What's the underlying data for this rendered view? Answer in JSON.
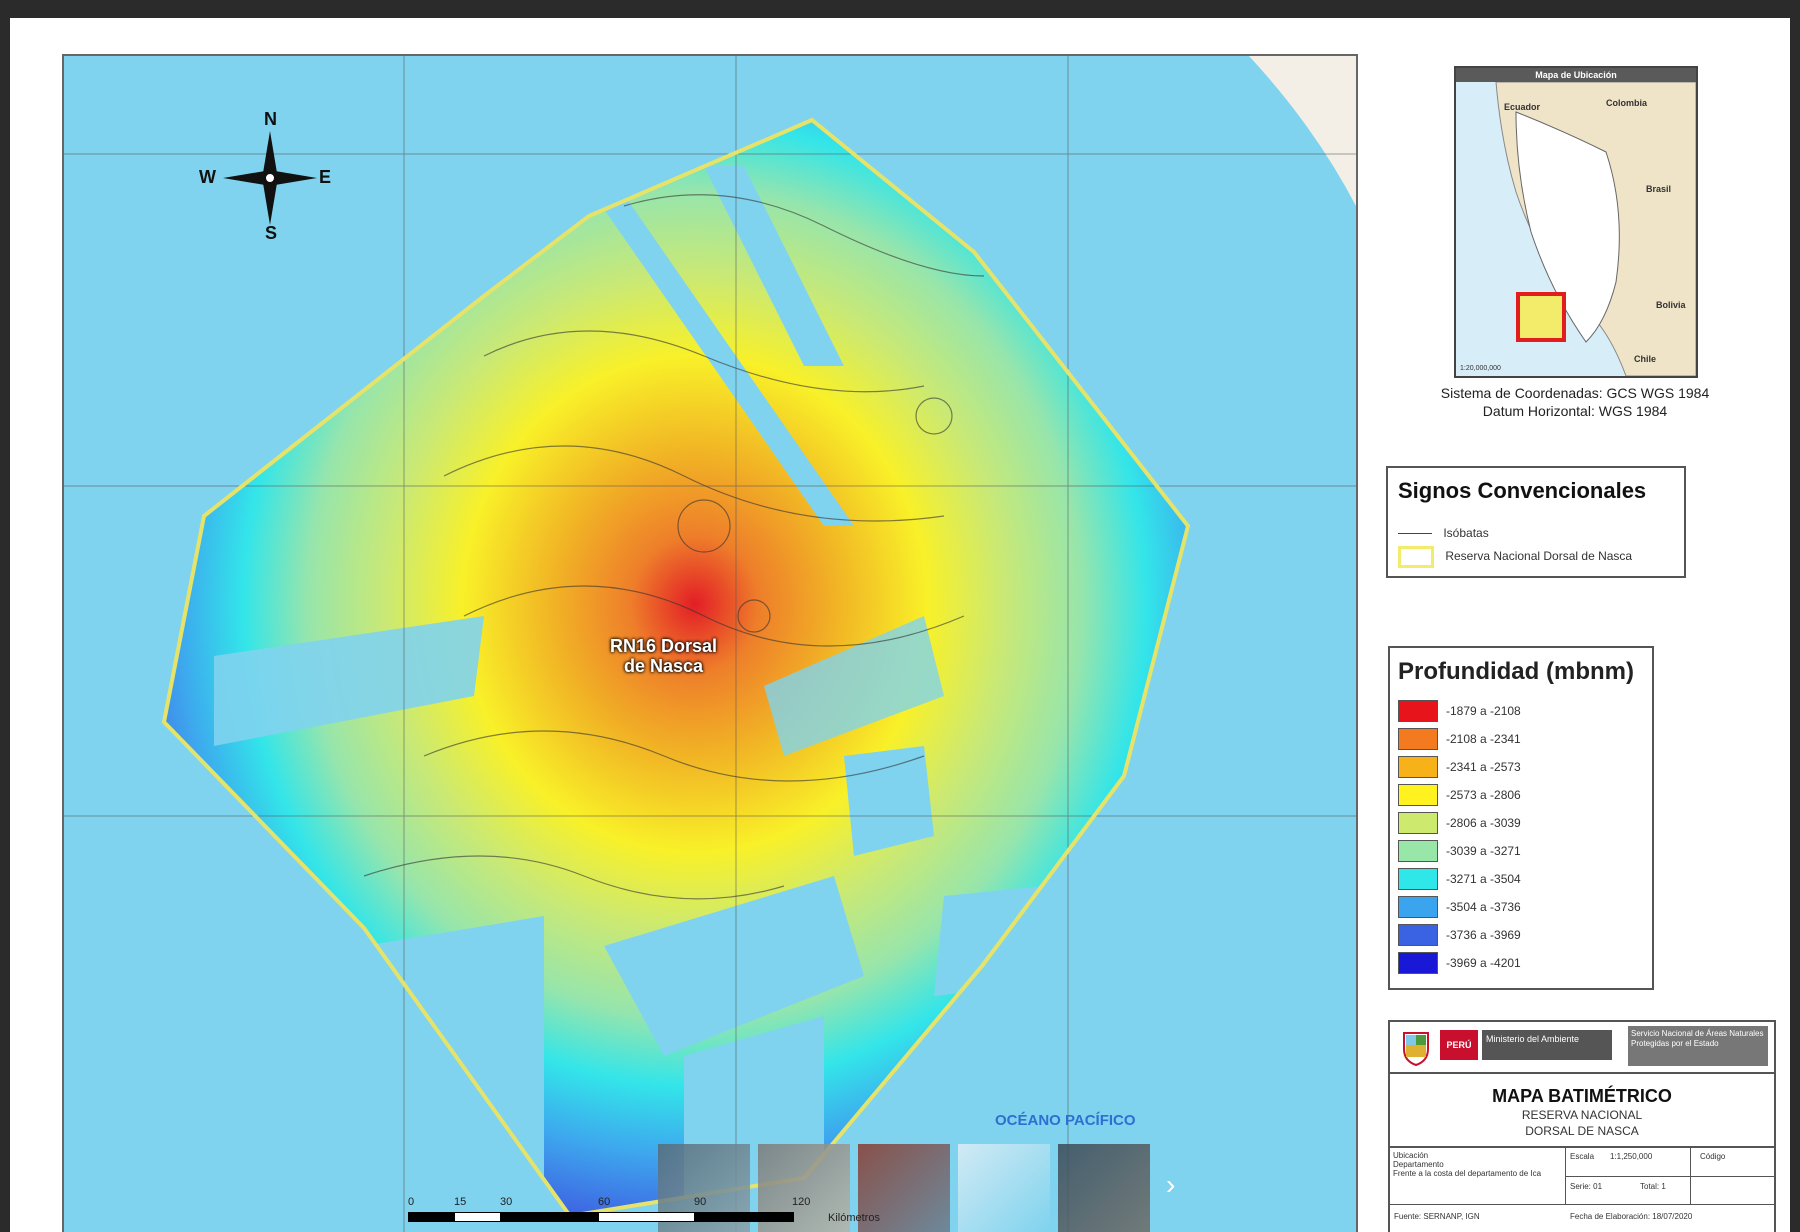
{
  "map": {
    "name_label_line1": "RN16 Dorsal",
    "name_label_line2": "de Nasca",
    "ocean_label": "OCÉANO PACÍFICO",
    "compass": {
      "n": "N",
      "s": "S",
      "e": "E",
      "w": "W"
    },
    "scale": {
      "ticks": [
        "0",
        "15",
        "30",
        "60",
        "90",
        "120"
      ],
      "unit": "Kilómetros"
    }
  },
  "location_map": {
    "title": "Mapa de Ubicación",
    "countries": [
      "Ecuador",
      "Colombia",
      "Brasil",
      "Bolivia",
      "Chile"
    ],
    "scale_text": "1:20,000,000"
  },
  "coordinate_system": {
    "line1": "Sistema de Coordenadas: GCS WGS 1984",
    "line2": "Datum Horizontal: WGS 1984"
  },
  "signos": {
    "title": "Signos Convencionales",
    "items": [
      {
        "label": "Isóbatas",
        "color": "#444444"
      },
      {
        "label": "Reserva Nacional Dorsal de Nasca",
        "color": "#f2ec6a"
      }
    ]
  },
  "profundidad": {
    "title": "Profundidad (mbnm)",
    "items": [
      {
        "label": "-1879 a -2108",
        "color": "#e8141c"
      },
      {
        "label": "-2108 a -2341",
        "color": "#f47a20"
      },
      {
        "label": "-2341 a -2573",
        "color": "#f7b21a"
      },
      {
        "label": "-2573 a -2806",
        "color": "#fff21e"
      },
      {
        "label": "-2806 a -3039",
        "color": "#cdea6f"
      },
      {
        "label": "-3039 a -3271",
        "color": "#98e6a8"
      },
      {
        "label": "-3271 a -3504",
        "color": "#2fe6e9"
      },
      {
        "label": "-3504 a -3736",
        "color": "#3aa5ee"
      },
      {
        "label": "-3736 a -3969",
        "color": "#3a63e3"
      },
      {
        "label": "-3969 a -4201",
        "color": "#1818d6"
      }
    ]
  },
  "title_block": {
    "peru": "PERÚ",
    "ministry": "Ministerio del Ambiente",
    "service": "Servicio Nacional de Áreas Naturales Protegidas por el Estado",
    "title": "MAPA BATIMÉTRICO",
    "subtitle1": "RESERVA NACIONAL",
    "subtitle2": "DORSAL DE NASCA",
    "ubicacion_label": "Ubicación",
    "departamento_label": "Departamento",
    "departamento_value": "Frente a la costa del departamento de Ica",
    "escala_label": "Escala",
    "escala_value": "1:1,250,000",
    "codigo_label": "Código",
    "serie_label": "Serie: 01",
    "total_label": "Total: 1",
    "fuente": "Fuente: SERNANP, IGN",
    "fecha": "Fecha de Elaboración: 18/07/2020"
  }
}
